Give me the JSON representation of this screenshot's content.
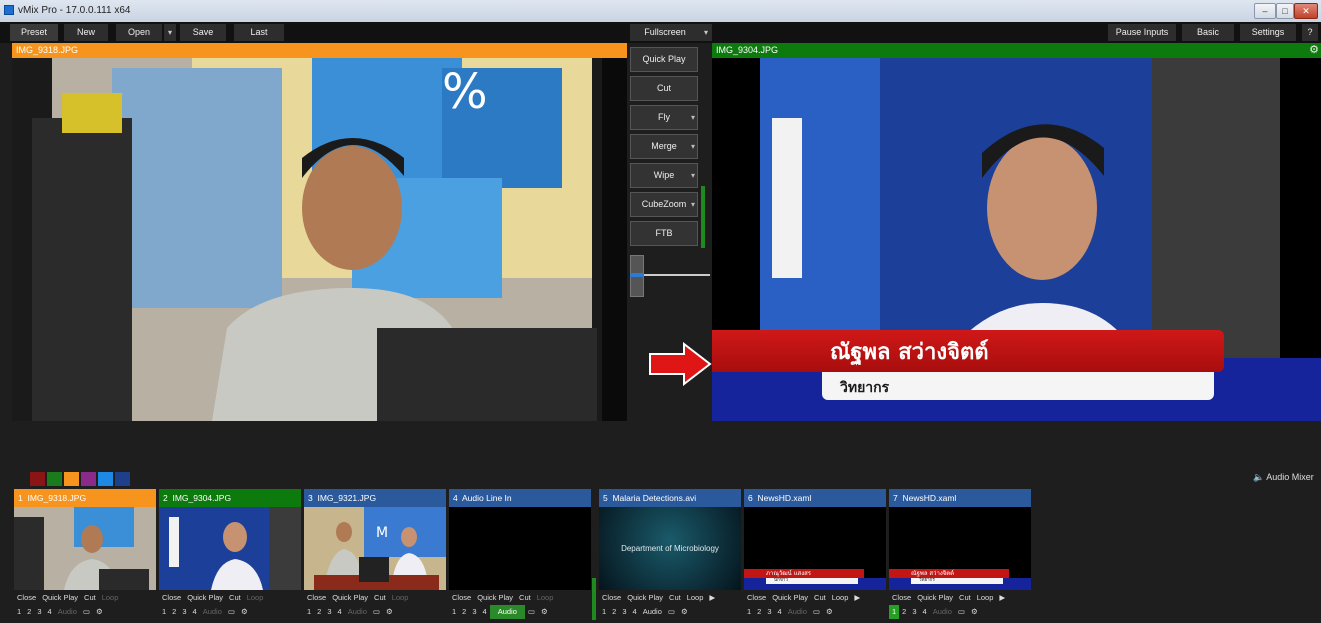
{
  "window": {
    "title": "vMix Pro - 17.0.0.111 x64"
  },
  "menubar": {
    "preset": "Preset",
    "new": "New",
    "open": "Open",
    "save": "Save",
    "last": "Last",
    "fullscreen": "Fullscreen",
    "pause_inputs": "Pause Inputs",
    "basic": "Basic",
    "settings": "Settings",
    "help": "?"
  },
  "preview": {
    "label": "IMG_9318.JPG"
  },
  "program": {
    "label": "IMG_9304.JPG",
    "lower_third_name": "ณัฐพล สว่างจิตต์",
    "lower_third_title": "วิทยากร"
  },
  "transitions": [
    "Quick Play",
    "Cut",
    "Fly",
    "Merge",
    "Wipe",
    "CubeZoom",
    "FTB"
  ],
  "colors": {
    "preview": "#f7941d",
    "program": "#0c7a0c",
    "input_blue": "#2a5a9c",
    "swatches": [
      "#8b1515",
      "#1b7a1b",
      "#f7941d",
      "#8a2a8a",
      "#1e88e5",
      "#1e3f8a"
    ]
  },
  "audio_mixer": "Audio Mixer",
  "audio_icon": "speaker-icon",
  "inputs": [
    {
      "number": "1",
      "name": "IMG_9318.JPG"
    },
    {
      "number": "2",
      "name": "IMG_9304.JPG"
    },
    {
      "number": "3",
      "name": "IMG_9321.JPG"
    },
    {
      "number": "4",
      "name": "Audio Line In"
    },
    {
      "number": "5",
      "name": "Malaria Detections.avi",
      "overlay_text": "Department of Microbiology"
    },
    {
      "number": "6",
      "name": "NewsHD.xaml",
      "lt_name": "ภาณุวัฒน์ แสงสร",
      "lt_title": "นักข่าว"
    },
    {
      "number": "7",
      "name": "NewsHD.xaml",
      "lt_name": "ณัฐพล สว่างจิตต์",
      "lt_title": "วิทยากร"
    }
  ],
  "controls": {
    "close": "Close",
    "quick_play": "Quick Play",
    "cut": "Cut",
    "loop": "Loop",
    "audio": "Audio",
    "overlays": [
      "1",
      "2",
      "3",
      "4"
    ]
  }
}
